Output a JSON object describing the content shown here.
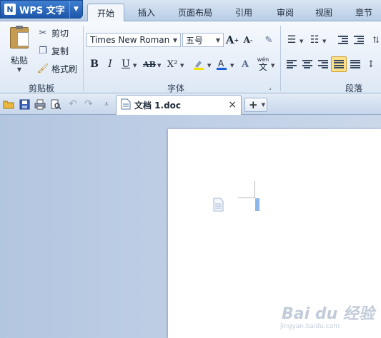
{
  "app": {
    "title": "WPS 文字"
  },
  "menu": {
    "tabs": [
      "开始",
      "插入",
      "页面布局",
      "引用",
      "审阅",
      "视图",
      "章节"
    ],
    "active": "开始"
  },
  "clipboard_group": {
    "paste": "粘贴",
    "cut": "剪切",
    "copy": "复制",
    "format_painter": "格式刷",
    "label": "剪贴板"
  },
  "font_group": {
    "font_name": "Times New Roman",
    "font_size": "五号",
    "label": "字体",
    "pinyin_glyph": "wén",
    "bold": "B",
    "italic": "I",
    "underline": "U",
    "strike": "AB",
    "superscript": "X²"
  },
  "paragraph_group": {
    "label": "段落"
  },
  "document_tab": {
    "name": "文档 1.doc",
    "close": "×",
    "new": "+"
  },
  "watermark": {
    "text": "Bai du 经验",
    "sub": "jingyan.baidu.com"
  },
  "colors": {
    "accent": "#1d56aa",
    "ribbon": "#eef3fa",
    "workspace": "#c5d3e6"
  }
}
